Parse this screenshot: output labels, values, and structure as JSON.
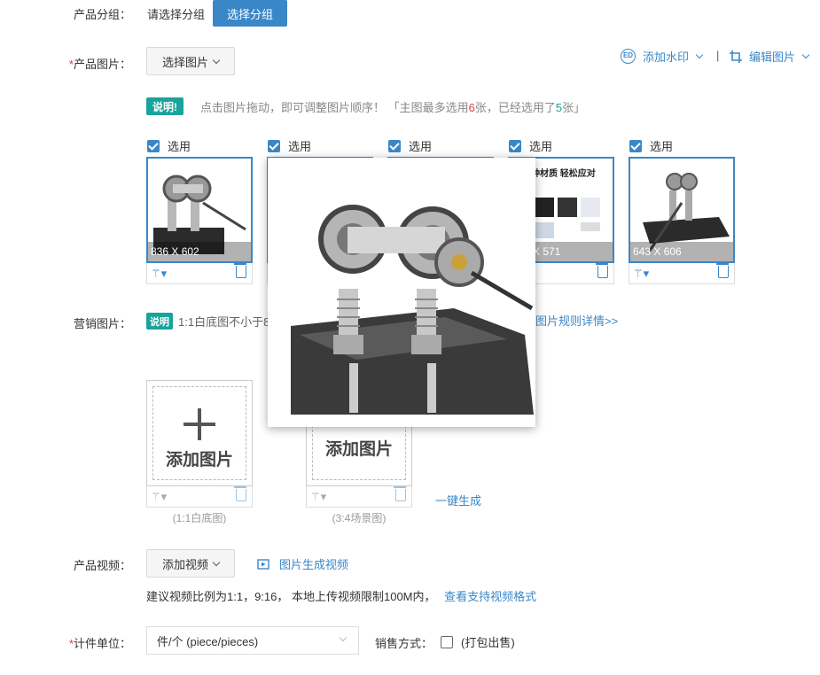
{
  "group": {
    "label": "产品分组：",
    "placeholder_text": "请选择分组",
    "button": "选择分组"
  },
  "images": {
    "required_mark": "*",
    "label": "产品图片：",
    "select_button": "选择图片",
    "watermark_button": "添加水印",
    "separator": "|",
    "edit_button": "编辑图片",
    "tag": "说明!",
    "note_pre": "点击图片拖动，即可调整图片顺序！ 「主图最多选用",
    "note_max": "6",
    "note_mid": "张，已经选用了",
    "note_used": "5",
    "note_post": "张」",
    "thumbs": [
      {
        "check": "选用",
        "dim": "836 X 602"
      },
      {
        "check": "选用",
        "dim": ""
      },
      {
        "check": "选用",
        "dim": ""
      },
      {
        "check": "选用",
        "dim": "X 571",
        "banner": "种材质 轻松应对"
      },
      {
        "check": "选用",
        "dim": "643 X 606"
      }
    ]
  },
  "marketing": {
    "label": "营销图片：",
    "tag": "说明",
    "note": "1:1白底图不小于8",
    "rule_link": "图片规则详情>>",
    "add_text": "添加图片",
    "captions": [
      "(1:1白底图)",
      "(3:4场景图)"
    ],
    "generate": "一键生成"
  },
  "video": {
    "label": "产品视频：",
    "select_button": "添加视频",
    "gen_link": "图片生成视频",
    "hint": "建议视频比例为1:1，9:16， 本地上传视频限制100M内，",
    "hint_link": "查看支持视频格式"
  },
  "unit": {
    "required_mark": "*",
    "label": "计件单位：",
    "value": "件/个 (piece/pieces)",
    "sale_label": "销售方式：",
    "pack_option": "(打包出售)"
  },
  "colors": {
    "accent": "#3a87c8",
    "tag": "#1aa39c",
    "required": "#e4393c"
  }
}
